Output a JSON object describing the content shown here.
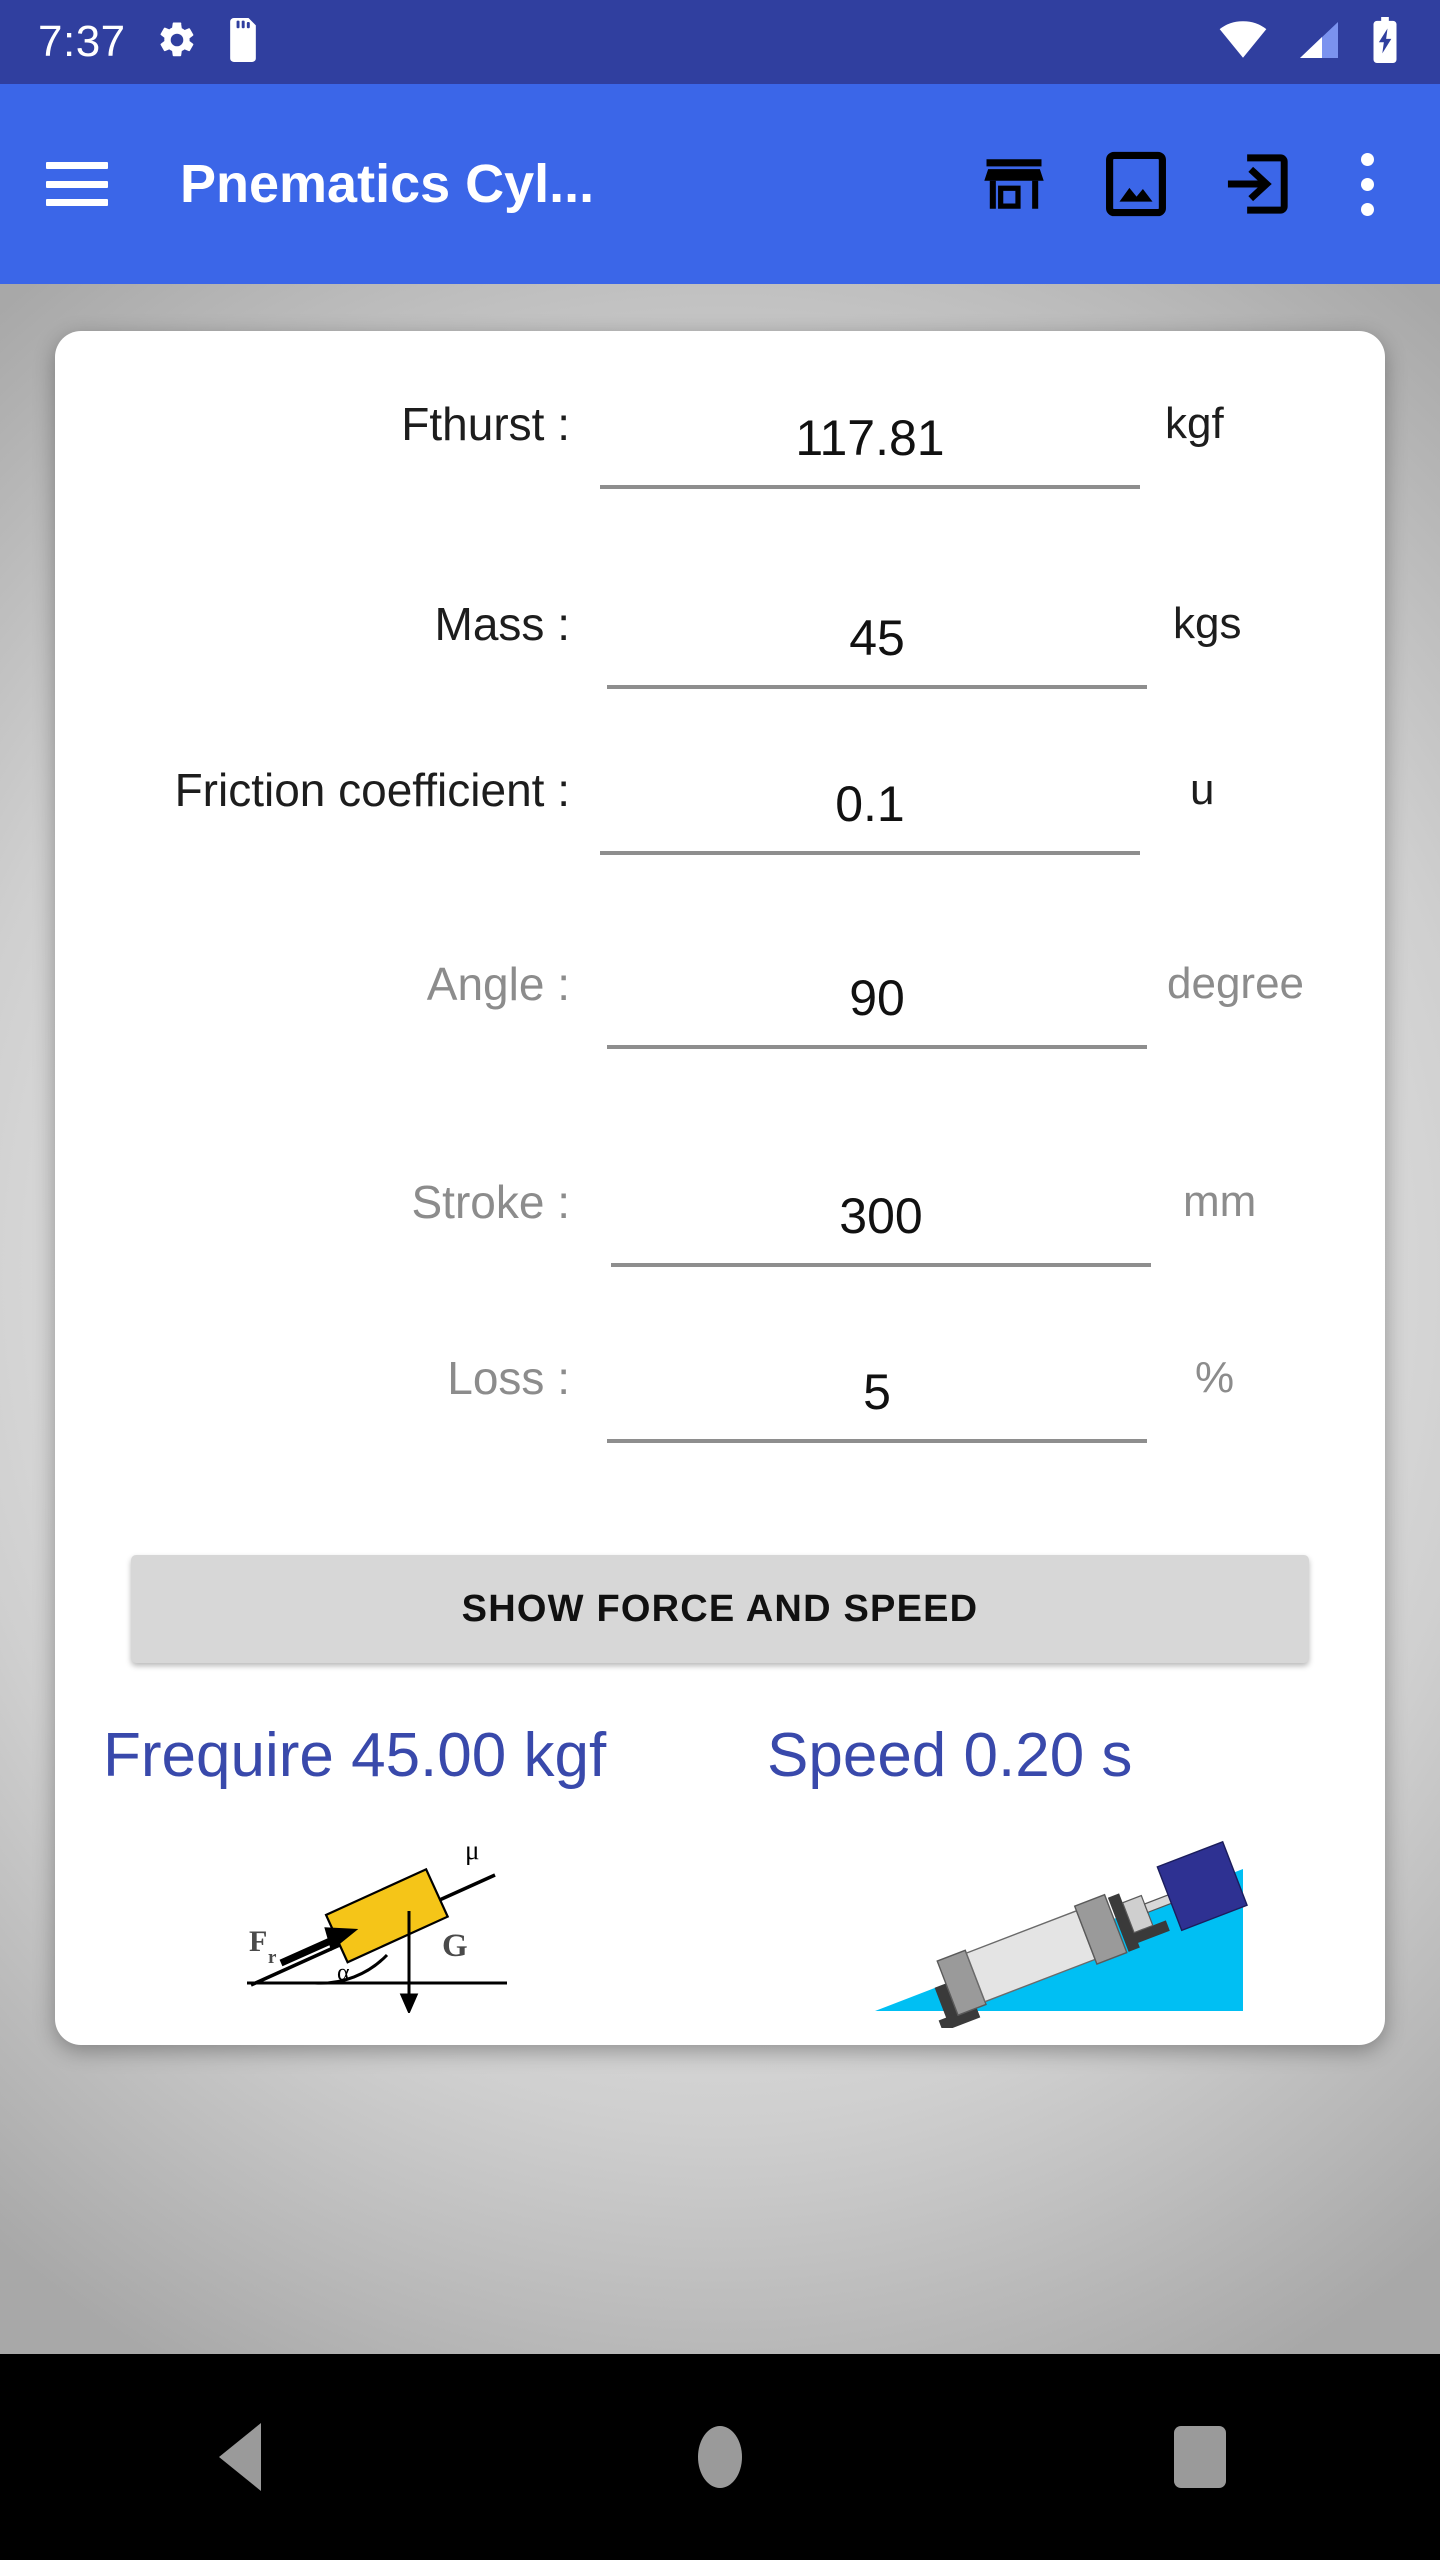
{
  "status_bar": {
    "time": "7:37",
    "left_icons": [
      "gear-icon",
      "sd-card-icon"
    ],
    "right_icons": [
      "wifi-icon",
      "cellular-signal-icon",
      "battery-charging-icon"
    ],
    "background_color": "#303F9F"
  },
  "app_bar": {
    "menu_icon": "hamburger-menu-icon",
    "title": "Pnematics Cyl...",
    "background_color": "#3B66E8",
    "actions": [
      {
        "name": "store-icon",
        "label": "Store"
      },
      {
        "name": "image-icon",
        "label": "Image"
      },
      {
        "name": "login-icon",
        "label": "Login"
      },
      {
        "name": "overflow-menu-icon",
        "label": "More options"
      }
    ]
  },
  "form": {
    "rows": [
      {
        "label": "Fthurst :",
        "value": "117.81",
        "unit": "kgf",
        "label_style": "dark",
        "unit_style": "dark"
      },
      {
        "label": "Mass :",
        "value": "45",
        "unit": "kgs",
        "label_style": "dark",
        "unit_style": "dark"
      },
      {
        "label": "Friction coefficient :",
        "value": "0.1",
        "unit": "u",
        "label_style": "dark",
        "unit_style": "dark"
      },
      {
        "label": "Angle :",
        "value": "90",
        "unit": "degree",
        "label_style": "gray",
        "unit_style": "gray"
      },
      {
        "label": "Stroke :",
        "value": "300",
        "unit": "mm",
        "label_style": "gray",
        "unit_style": "gray"
      },
      {
        "label": "Loss :",
        "value": "5",
        "unit": "%",
        "label_style": "gray",
        "unit_style": "gray"
      }
    ]
  },
  "action_button": {
    "label": "SHOW FORCE AND SPEED",
    "background_color": "#d7d7d7"
  },
  "results": {
    "force": "Frequire 45.00 kgf",
    "speed": "Speed 0.20 s",
    "color": "#3949AB"
  },
  "figures": {
    "incline_force_diagram": {
      "name": "inclined-plane-force-diagram",
      "labels": {
        "friction_force": "F",
        "friction_force_sub": "r",
        "mu": "μ",
        "gravity": "G",
        "angle": "α"
      },
      "block_color": "#F5C518"
    },
    "cylinder_diagram": {
      "name": "pneumatic-cylinder-incline-diagram",
      "ramp_color": "#00BFF3",
      "load_color": "#2E3192"
    }
  },
  "nav_bar": {
    "background_color": "#000000",
    "buttons": [
      {
        "name": "nav-back-button",
        "label": "Back"
      },
      {
        "name": "nav-home-button",
        "label": "Home"
      },
      {
        "name": "nav-recents-button",
        "label": "Recents"
      }
    ]
  }
}
